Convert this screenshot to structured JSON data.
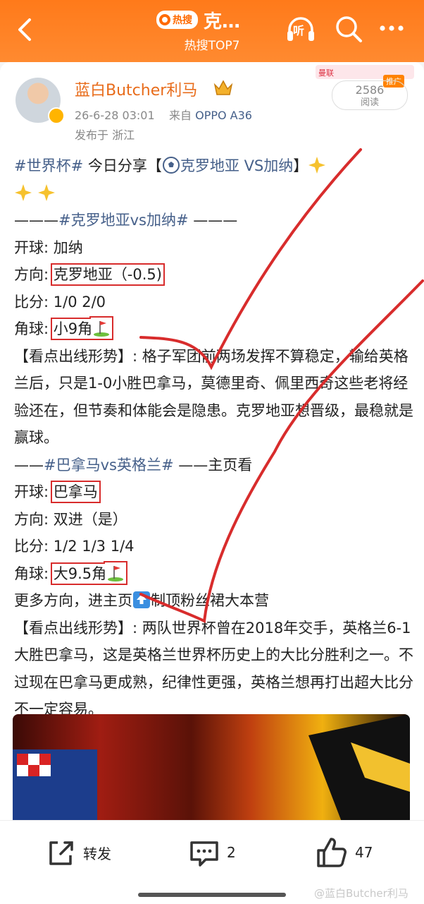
{
  "header": {
    "badge_label": "热搜",
    "title": "克…",
    "subtitle": "热搜TOP7",
    "listen_label": "听"
  },
  "colors": {
    "accent": "#ff7a1a",
    "link": "#46608a",
    "username": "#e86c1b",
    "annotation": "#d82c2c"
  },
  "author": {
    "name": "蓝白Butcher利马",
    "time": "26-6-28 03:01",
    "from_prefix": "来自",
    "device": "OPPO A36",
    "location": "发布于 浙江"
  },
  "ad": {
    "banner_text": "曼联",
    "tag": "推广"
  },
  "reads": {
    "count": "2586",
    "label": "阅读"
  },
  "post": {
    "l1_tag": "#世界杯#",
    "l1_text": " 今日分享【",
    "l1_tag2": "克罗地亚 VS加纳",
    "l1_end": "】",
    "l3_prefix": "———",
    "l3_tag": "#克罗地亚vs加纳#",
    "l3_suffix": " ———",
    "m1_kick_label": "开球: ",
    "m1_kick_value": "加纳",
    "m1_dir_label": "方向: ",
    "m1_dir_value": "克罗地亚（-0.5)",
    "m1_score_label": "比分: ",
    "m1_score_value": "1/0 2/0",
    "m1_corner_label": "角球: ",
    "m1_corner_value": "小9角",
    "m1_analysis": "【看点出线形势】: 格子军团前两场发挥不算稳定，输给英格兰后，只是1-0小胜巴拿马，莫德里奇、佩里西奇这些老将经验还在，但节奏和体能会是隐患。克罗地亚想晋级，最稳就是赢球。",
    "l2_prefix": "——",
    "l2_tag": "#巴拿马vs英格兰#",
    "l2_suffix": " ——主页看",
    "m2_kick_label": "开球: ",
    "m2_kick_value": "巴拿马",
    "m2_dir_label": "方向: ",
    "m2_dir_value": "双进（是）",
    "m2_score_label": "比分: ",
    "m2_score_value": "1/2 1/3 1/4",
    "m2_corner_label": "角球: ",
    "m2_corner_value": "大9.5角",
    "more_a": "更多方向，进主页",
    "more_b": "制顶粉丝裙大本营",
    "m2_analysis": "【看点出线形势】: 两队世界杯曾在2018年交手，英格兰6-1大胜巴拿马，这是英格兰世界杯历史上的大比分胜利之一。不过现在巴拿马更成熟，纪律性更强，英格兰想再打出超大比分不一定容易。"
  },
  "actions": {
    "repost_label": "转发",
    "comment_count": "2",
    "like_count": "47"
  },
  "watermark": "@蓝白Butcher利马"
}
